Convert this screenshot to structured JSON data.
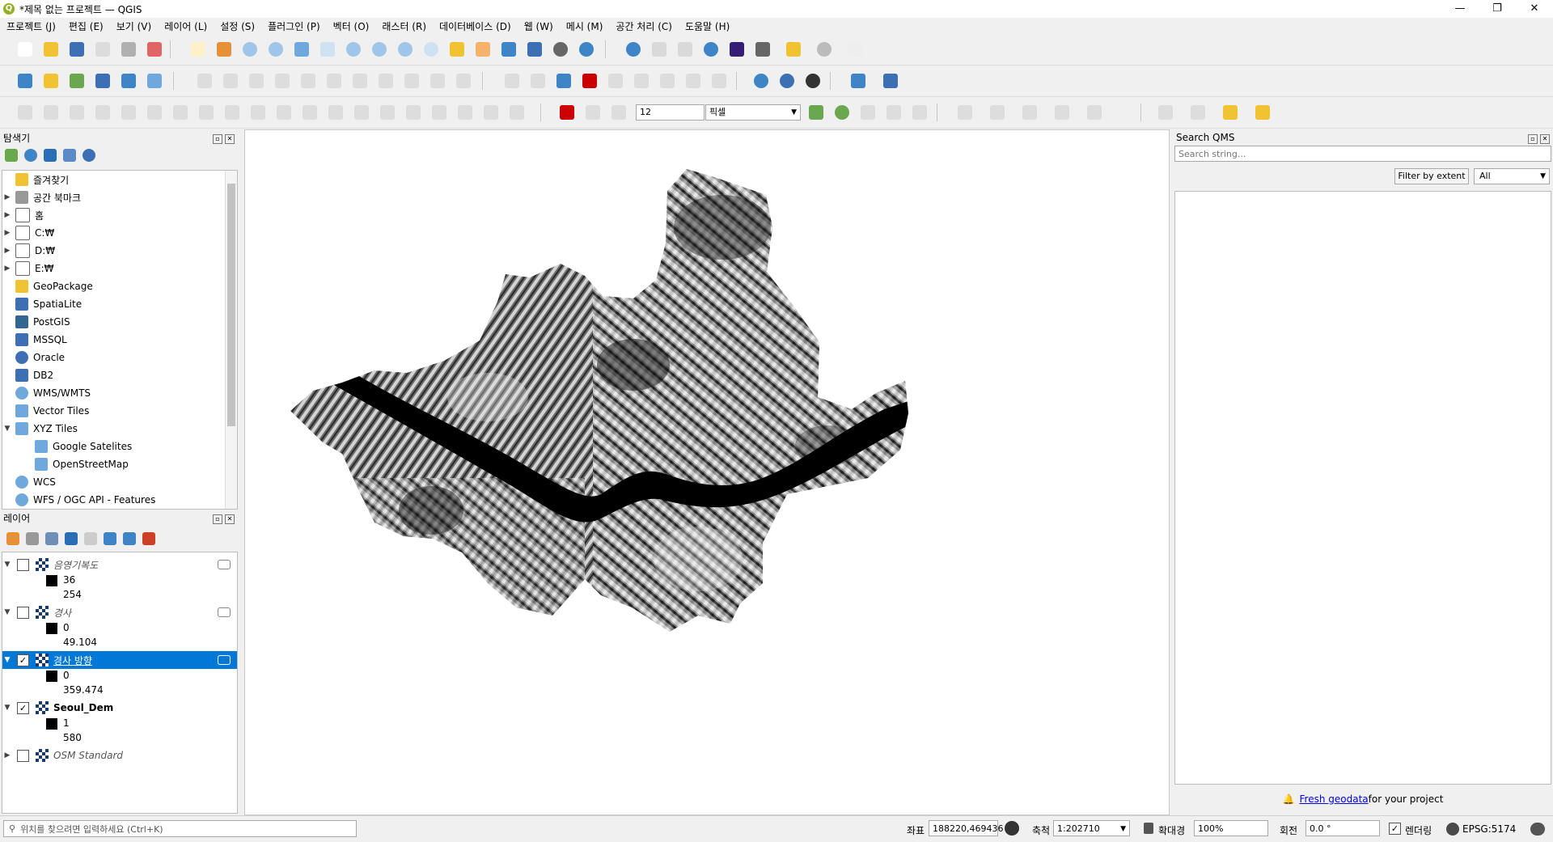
{
  "window": {
    "title": "*제목 없는 프로젝트 — QGIS",
    "logo": "Q"
  },
  "menu": [
    "프로젝트 (J)",
    "편집 (E)",
    "보기 (V)",
    "레이어 (L)",
    "설정 (S)",
    "플러그인 (P)",
    "벡터 (O)",
    "래스터 (R)",
    "데이터베이스 (D)",
    "웹 (W)",
    "메시 (M)",
    "공간 처리 (C)",
    "도움말 (H)"
  ],
  "snapping": {
    "tolerance": "12",
    "units": "픽셀"
  },
  "browser": {
    "title": "탐색기",
    "items": [
      {
        "label": "즐겨찾기",
        "expand": "",
        "icon": "star-icon"
      },
      {
        "label": "공간 북마크",
        "expand": "▶",
        "icon": "bookmark-icon"
      },
      {
        "label": "홈",
        "expand": "▶",
        "icon": "home-folder-icon"
      },
      {
        "label": "C:₩",
        "expand": "▶",
        "icon": "folder-icon"
      },
      {
        "label": "D:₩",
        "expand": "▶",
        "icon": "folder-icon"
      },
      {
        "label": "E:₩",
        "expand": "▶",
        "icon": "folder-icon"
      },
      {
        "label": "GeoPackage",
        "expand": "",
        "icon": "geopackage-icon"
      },
      {
        "label": "SpatiaLite",
        "expand": "",
        "icon": "spatialite-icon"
      },
      {
        "label": "PostGIS",
        "expand": "",
        "icon": "postgis-icon"
      },
      {
        "label": "MSSQL",
        "expand": "",
        "icon": "mssql-icon"
      },
      {
        "label": "Oracle",
        "expand": "",
        "icon": "oracle-icon"
      },
      {
        "label": "DB2",
        "expand": "",
        "icon": "db2-icon"
      },
      {
        "label": "WMS/WMTS",
        "expand": "",
        "icon": "globe-icon"
      },
      {
        "label": "Vector Tiles",
        "expand": "",
        "icon": "grid-icon"
      },
      {
        "label": "XYZ Tiles",
        "expand": "▼",
        "icon": "grid-icon"
      },
      {
        "label": "Google Satelites",
        "expand": "",
        "icon": "grid-icon",
        "child": true
      },
      {
        "label": "OpenStreetMap",
        "expand": "",
        "icon": "grid-icon",
        "child": true
      },
      {
        "label": "WCS",
        "expand": "",
        "icon": "globe-icon"
      },
      {
        "label": "WFS / OGC API - Features",
        "expand": "",
        "icon": "globe-icon"
      }
    ]
  },
  "layers": {
    "title": "레이어",
    "items": [
      {
        "name": "음영기복도",
        "checked": false,
        "italic": true,
        "selected": false,
        "min": "36",
        "max": "254"
      },
      {
        "name": "경사",
        "checked": false,
        "italic": true,
        "selected": false,
        "min": "0",
        "max": "49.104"
      },
      {
        "name": "경사 방향",
        "checked": true,
        "italic": false,
        "selected": true,
        "min": "0",
        "max": "359.474"
      },
      {
        "name": "Seoul_Dem",
        "checked": true,
        "italic": false,
        "selected": false,
        "bold": true,
        "min": "1",
        "max": "580"
      },
      {
        "name": "OSM Standard",
        "checked": false,
        "italic": true,
        "selected": false
      }
    ]
  },
  "qms": {
    "title": "Search QMS",
    "search_placeholder": "Search string...",
    "filter_button": "Filter by extent",
    "filter_value": "All",
    "footer_link": "Fresh geodata",
    "footer_text": " for your project"
  },
  "status": {
    "locate_placeholder": "위치를 찾으려면 입력하세요 (Ctrl+K)",
    "coord_label": "좌표",
    "coord_value": "188220,469436",
    "scale_label": "축척",
    "scale_value": "1:202710",
    "magnifier_label": "확대경",
    "magnifier_value": "100%",
    "rotation_label": "회전",
    "rotation_value": "0.0 °",
    "render_label": "렌더링",
    "crs": "EPSG:5174"
  },
  "colors": {
    "selection": "#0078d7",
    "link": "#0000ee"
  }
}
